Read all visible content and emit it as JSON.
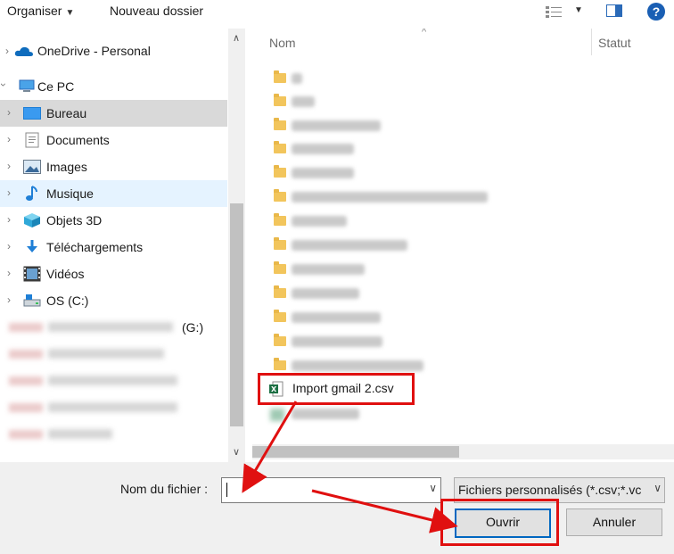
{
  "toolbar": {
    "organize": "Organiser",
    "new_folder": "Nouveau dossier"
  },
  "nav": {
    "items": [
      {
        "label": "OneDrive - Personal",
        "icon": "cloud-icon"
      },
      {
        "label": "Ce PC",
        "icon": "computer-icon"
      },
      {
        "label": "Bureau",
        "icon": "desktop-icon"
      },
      {
        "label": "Documents",
        "icon": "documents-icon"
      },
      {
        "label": "Images",
        "icon": "pictures-icon"
      },
      {
        "label": "Musique",
        "icon": "music-icon"
      },
      {
        "label": "Objets 3D",
        "icon": "3d-objects-icon"
      },
      {
        "label": "Téléchargements",
        "icon": "downloads-icon"
      },
      {
        "label": "Vidéos",
        "icon": "videos-icon"
      },
      {
        "label": "OS (C:)",
        "icon": "drive-icon"
      }
    ],
    "drive_g_suffix": "(G:)"
  },
  "list": {
    "columns": {
      "name": "Nom",
      "status": "Statut"
    },
    "highlighted_file": "Import gmail 2.csv"
  },
  "footer": {
    "filename_label": "Nom du fichier :",
    "filename_value": "",
    "filter_value": "Fichiers personnalisés (*.csv;*.vc",
    "open_button": "Ouvrir",
    "cancel_button": "Annuler"
  },
  "colors": {
    "annotation_red": "#e01010",
    "selected_row": "#d9d9d9",
    "hover_row": "#e5f3ff",
    "excel_green": "#1d7044"
  }
}
